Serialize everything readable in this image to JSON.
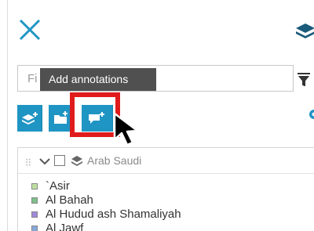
{
  "filter": {
    "placeholder_visible": "Fi"
  },
  "tooltip": {
    "text": "Add annotations"
  },
  "toolbar": {
    "buttons": [
      {
        "name": "add-layer-button",
        "icon": "layers-plus-icon"
      },
      {
        "name": "folder-button",
        "icon": "folder-plus-icon"
      },
      {
        "name": "add-annotations-button",
        "icon": "annotation-plus-icon"
      }
    ],
    "accent_color": "#1f95c4",
    "highlight_color": "#e01b1b"
  },
  "legend": {
    "group_label": "Arab Saudi",
    "items": [
      {
        "label": "`Asir",
        "color": "#bfe0a0"
      },
      {
        "label": "Al Bahah",
        "color": "#7cc08a"
      },
      {
        "label": "Al Hudud ash Shamaliyah",
        "color": "#a088d8"
      },
      {
        "label": "Al Jawf",
        "color": "#88a8d8"
      }
    ]
  }
}
